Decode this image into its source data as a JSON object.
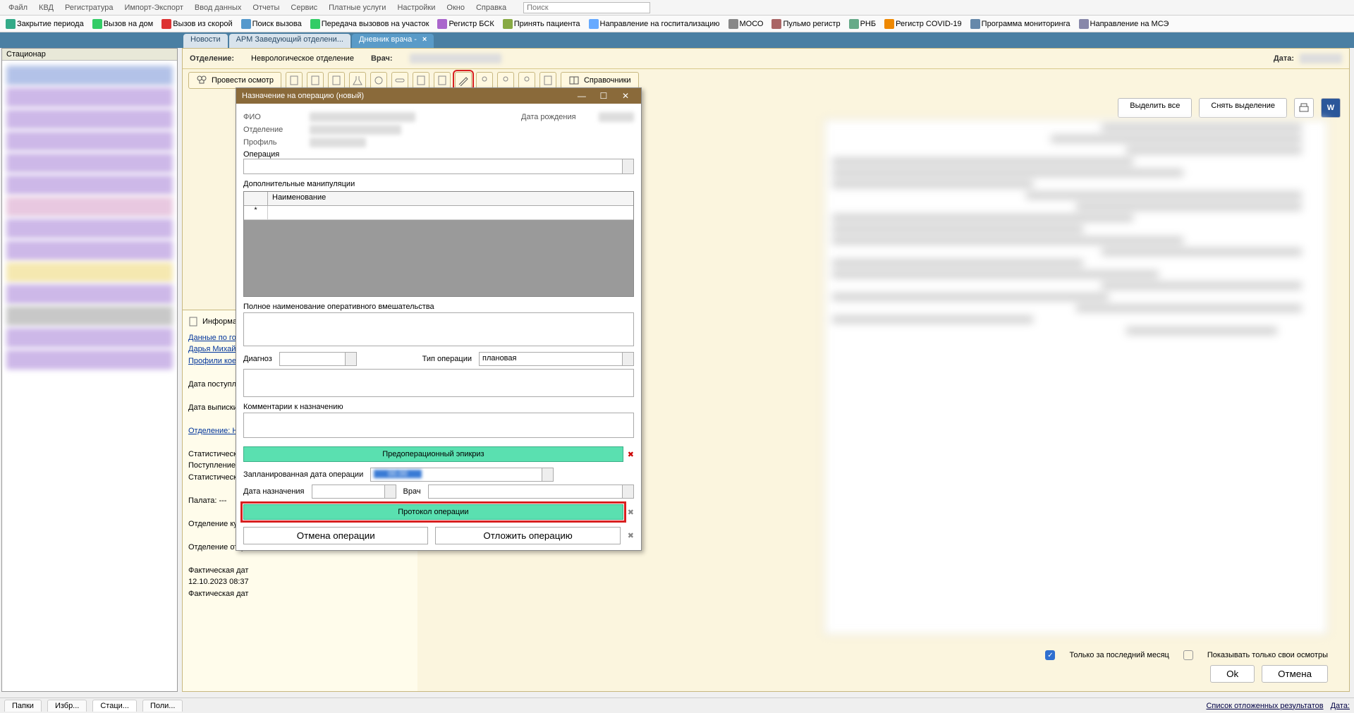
{
  "menu": [
    "Файл",
    "КВД",
    "Регистратура",
    "Импорт-Экспорт",
    "Ввод данных",
    "Отчеты",
    "Сервис",
    "Платные услуги",
    "Настройки",
    "Окно",
    "Справка"
  ],
  "search_ph": "Поиск",
  "tb1": [
    {
      "t": "Закрытие периода",
      "c": "#3a8"
    },
    {
      "t": "Вызов на дом",
      "c": "#3c6"
    },
    {
      "t": "Вызов из скорой",
      "c": "#d33"
    },
    {
      "t": "Поиск вызова",
      "c": "#59c"
    },
    {
      "t": "Передача вызовов на участок",
      "c": "#3c6"
    },
    {
      "t": "Регистр БСК",
      "c": "#a6c"
    },
    {
      "t": "Принять пациента",
      "c": "#8a4"
    },
    {
      "t": "Направление на госпитализацию",
      "c": "#6af"
    },
    {
      "t": "МОСО",
      "c": "#888"
    },
    {
      "t": "Пульмо регистр",
      "c": "#a66"
    },
    {
      "t": "РНБ",
      "c": "#6a8"
    },
    {
      "t": "Регистр COVID-19",
      "c": "#e80"
    },
    {
      "t": "Программа мониторинга",
      "c": "#68a"
    },
    {
      "t": "Направление на МСЭ",
      "c": "#88a"
    }
  ],
  "left_header": "Стационар",
  "tabs": [
    {
      "t": "Новости"
    },
    {
      "t": "АРМ Заведующий отделени..."
    },
    {
      "t": "Дневник врача -",
      "active": true
    }
  ],
  "mh": {
    "dep_l": "Отделение:",
    "dep_v": "Неврологическое отделение",
    "doc_l": "Врач:",
    "date_l": "Дата:"
  },
  "tool2": {
    "exam": "Провести осмотр",
    "ref": "Справочники"
  },
  "sel": {
    "all": "Выделить все",
    "none": "Снять выделение"
  },
  "checks": {
    "last": "Только за последний месяц",
    "own": "Показывать только свои осмотры"
  },
  "okc": {
    "ok": "Ok",
    "cancel": "Отмена"
  },
  "info": {
    "head": "Информация",
    "l1a": "Данные по госпи",
    "l1b": "Дарья Михайлов",
    "l1c": "Профили коек: Р",
    "l2": "Дата поступлени",
    "l3": "Дата выписки: --",
    "l4": "Отделение: Невр",
    "l5": "Статистический т",
    "l6": "Поступление",
    "l7": "Статистический т",
    "l8": "Палата: ---",
    "l9": "Отделение куда:",
    "l10": "Отделение отку",
    "l11": "Фактическая дат",
    "l12": "12.10.2023 08:37",
    "l13": "Фактическая дат"
  },
  "modal": {
    "title": "Назначение на операцию (новый)",
    "fio": "ФИО",
    "dob": "Дата рождения",
    "dep": "Отделение",
    "prof": "Профиль",
    "op": "Операция",
    "manip": "Дополнительные манипуляции",
    "mcol": "Наименование",
    "full": "Полное наименование оперативного вмешательства",
    "diag": "Диагноз",
    "otype": "Тип операции",
    "otype_v": "плановая",
    "comm": "Комментарии к назначению",
    "preop": "Предоперационный эпикриз",
    "pdate": "Запланированная дата операции",
    "adate": "Дата назначения",
    "doc": "Врач",
    "proto": "Протокол операции",
    "cancel_op": "Отмена операции",
    "postpone": "Отложить операцию"
  },
  "sb": {
    "t1": "Папки",
    "t2": "Избр...",
    "t3": "Стаци...",
    "t4": "Поли...",
    "r1": "Список отложенных результатов",
    "r2": "Дата:"
  }
}
